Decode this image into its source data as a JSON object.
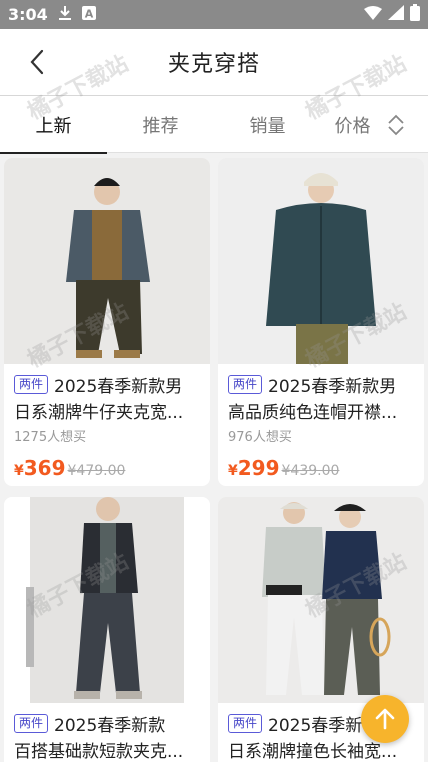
{
  "status_bar": {
    "time": "3:04",
    "icons": [
      "download-icon",
      "a-box-icon",
      "wifi-icon",
      "signal-icon",
      "battery-icon"
    ]
  },
  "header": {
    "title": "夹克穿搭"
  },
  "tabs": [
    {
      "label": "上新",
      "active": true
    },
    {
      "label": "推荐",
      "active": false
    },
    {
      "label": "销量",
      "active": false
    },
    {
      "label": "价格",
      "active": false
    }
  ],
  "watermark": "橘子下载站",
  "products": [
    {
      "badge": "两件",
      "title_line1": "2025春季新款男",
      "title_line2": "日系潮牌牛仔夹克宽...",
      "wants": "1275人想买",
      "price": "369",
      "price_symbol": "¥",
      "original_price": "¥479.00"
    },
    {
      "badge": "两件",
      "title_line1": "2025春季新款男",
      "title_line2": "高品质纯色连帽开襟...",
      "wants": "976人想买",
      "price": "299",
      "price_symbol": "¥",
      "original_price": "¥439.00"
    },
    {
      "badge": "两件",
      "title_line1": "2025春季新款",
      "title_line2": "百搭基础款短款夹克...",
      "wants": "",
      "price": "",
      "price_symbol": "",
      "original_price": ""
    },
    {
      "badge": "两件",
      "title_line1": "2025春季新",
      "title_line2": "日系潮牌撞色长袖宽...",
      "wants": "",
      "price": "",
      "price_symbol": "",
      "original_price": ""
    }
  ],
  "colors": {
    "price": "#f25a1f",
    "badge": "#4646c8",
    "fab": "#f7b42c",
    "status_bar": "#8a8a8a"
  }
}
